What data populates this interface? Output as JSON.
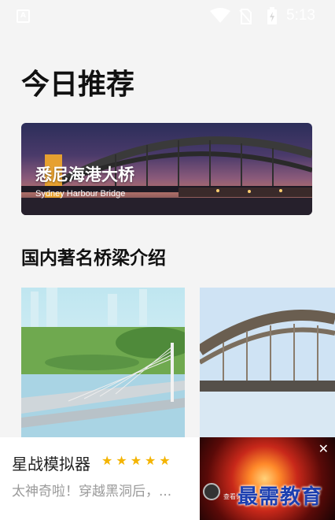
{
  "status_bar": {
    "app_icon_letter": "A",
    "time": "5:13"
  },
  "page_title": "今日推荐",
  "hero": {
    "title": "悉尼海港大桥",
    "subtitle": "Sydney Harbour Bridge"
  },
  "section_title": "国内著名桥梁介绍",
  "ad": {
    "title": "星战模拟器",
    "stars": "★★★★★",
    "rating_stars": 5,
    "description": "太神奇啦！穿越黑洞后，...",
    "close_label": "✕",
    "tag": "查看详情"
  },
  "watermark": "最需教育"
}
